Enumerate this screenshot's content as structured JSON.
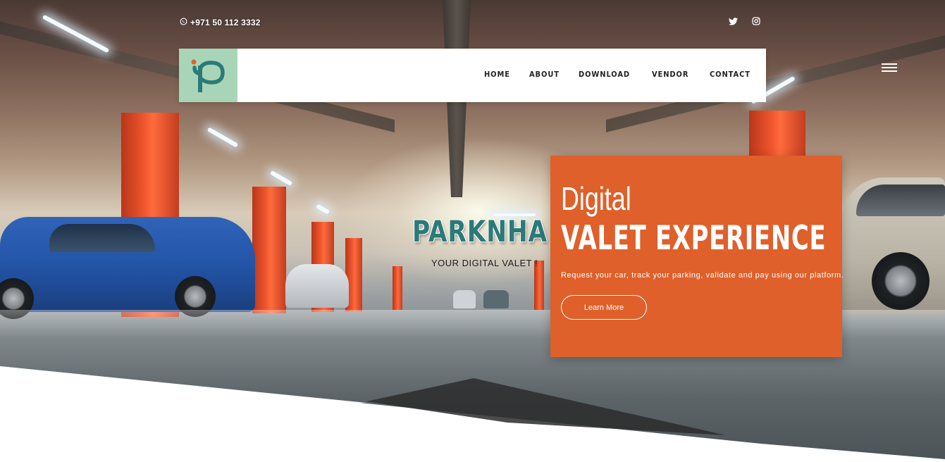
{
  "topbar": {
    "phone": "+971 50 112 3332",
    "social": [
      "twitter-icon",
      "instagram-icon"
    ]
  },
  "navbar": {
    "logo_alt": "logo",
    "items": [
      {
        "label": "HOME"
      },
      {
        "label": "ABOUT"
      },
      {
        "label": "DOWNLOAD"
      },
      {
        "label": "VENDOR"
      },
      {
        "label": "CONTACT"
      }
    ]
  },
  "hero": {
    "brand": "PARKNHA",
    "tagline": "YOUR DIGITAL VALET !"
  },
  "card": {
    "pre_title": "Digital",
    "title": "VALET EXPERIENCE",
    "description": "Request your car, track your parking, validate and pay using our platform.",
    "button": "Learn More"
  },
  "colors": {
    "accent_orange": "#df602a",
    "brand_teal": "#2b7a78",
    "logo_bg": "#a8d5b8",
    "pillar_orange": "#f0562d"
  }
}
